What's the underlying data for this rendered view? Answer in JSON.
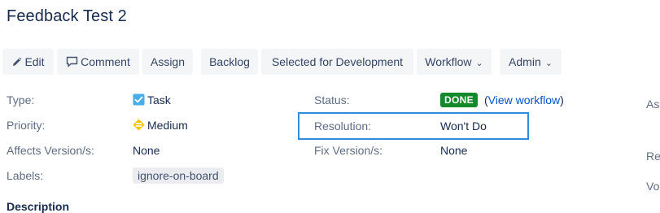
{
  "issue": {
    "title": "Feedback Test 2"
  },
  "toolbar": {
    "edit_label": "Edit",
    "comment_label": "Comment",
    "assign_label": "Assign",
    "backlog_label": "Backlog",
    "selected_label": "Selected for Development",
    "workflow_label": "Workflow",
    "admin_label": "Admin"
  },
  "details": {
    "type_label": "Type:",
    "type_value": "Task",
    "priority_label": "Priority:",
    "priority_value": "Medium",
    "affects_label": "Affects Version/s:",
    "affects_value": "None",
    "labels_label": "Labels:",
    "labels_value": "ignore-on-board",
    "status_label": "Status:",
    "status_value": "DONE",
    "view_workflow_open": "(",
    "view_workflow_link": "View workflow",
    "view_workflow_close": ")",
    "resolution_label": "Resolution:",
    "resolution_value": "Won't Do",
    "fix_label": "Fix Version/s:",
    "fix_value": "None"
  },
  "description_heading": "Description",
  "right_panel": {
    "edge_1": "As",
    "edge_2": "Re",
    "edge_3": "Vo"
  },
  "colors": {
    "status_done": "#14892c",
    "highlight": "#2e8bde",
    "link": "#0052cc",
    "task_icon": "#4bade8",
    "priority_medium": "#f7c600"
  },
  "icons": {
    "edit": "pencil-icon",
    "comment": "comment-icon",
    "dropdown": "chevron-down-icon",
    "type": "task-checkbox-icon",
    "priority": "priority-medium-icon"
  }
}
